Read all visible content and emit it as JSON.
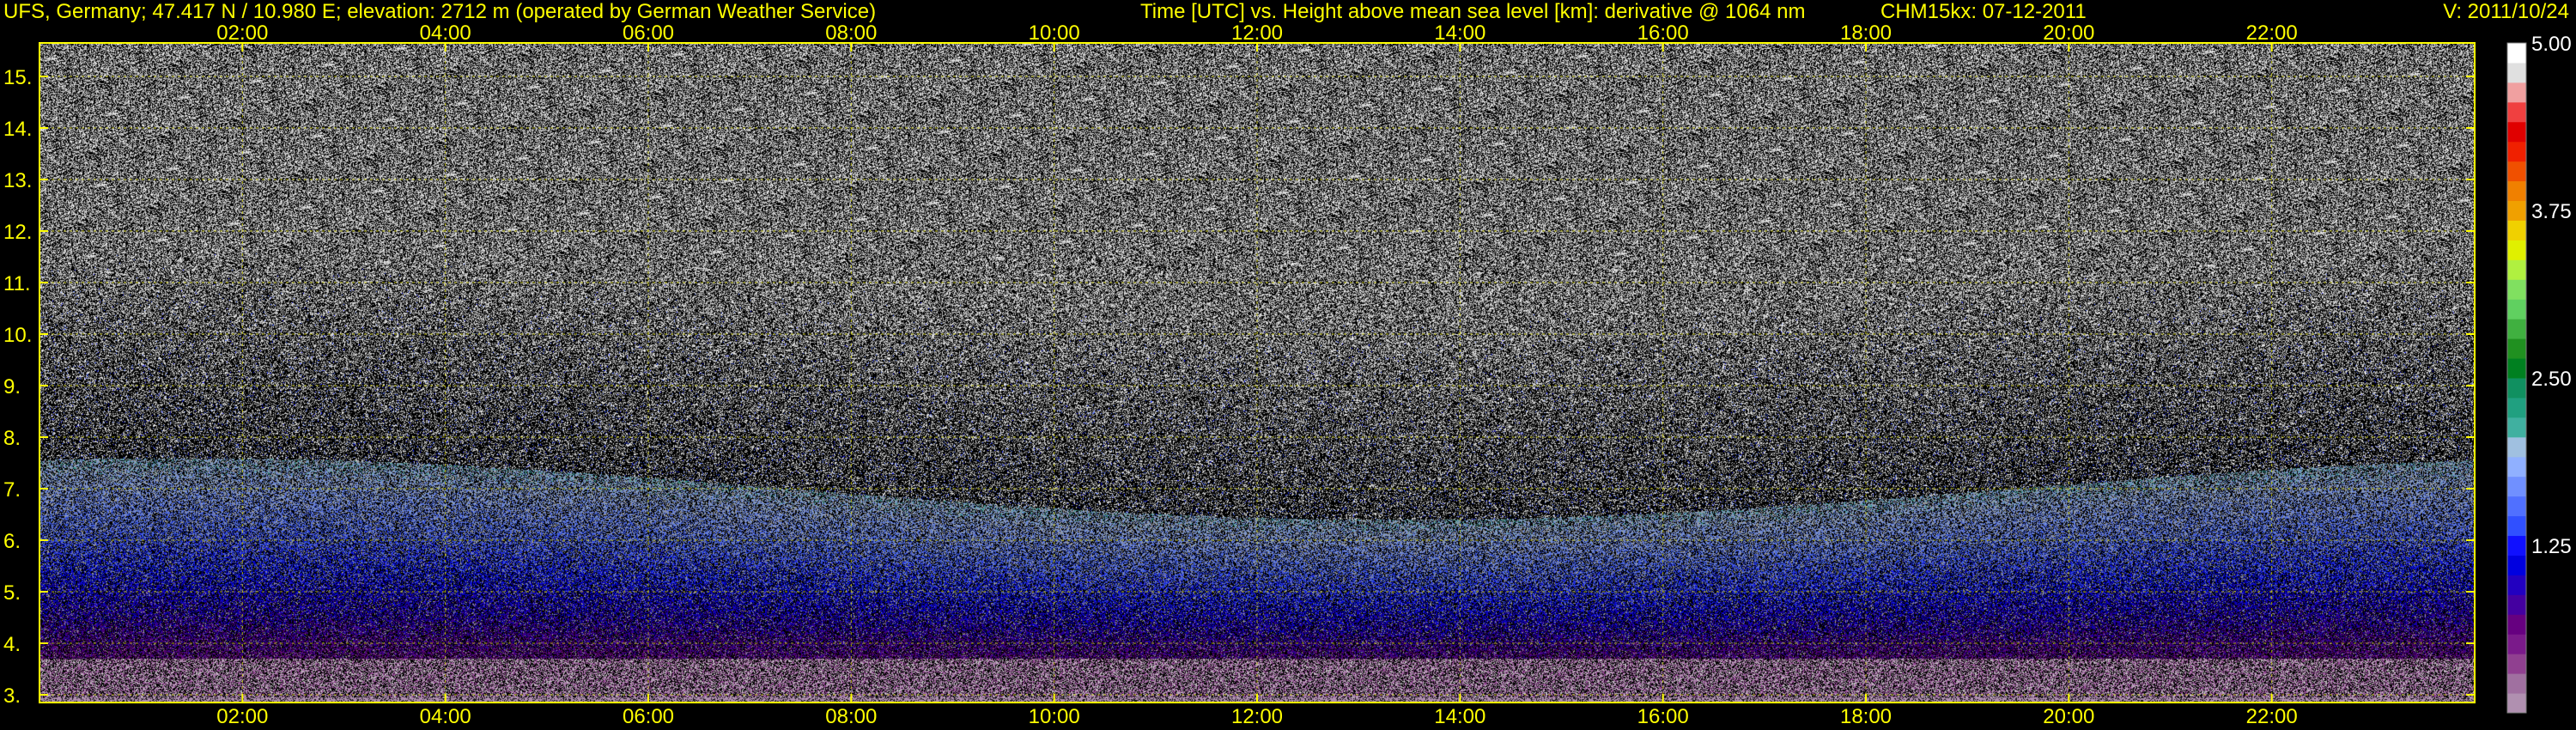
{
  "header": {
    "station": "UFS, Germany; 47.417 N / 10.980 E; elevation: 2712 m  (operated by German Weather Service)",
    "title": "Time [UTC] vs. Height above mean sea level [km]: derivative @ 1064 nm",
    "instrument": "CHM15kx: 07-12-2011",
    "version": "V: 2011/10/24"
  },
  "chart_data": {
    "type": "heatmap",
    "title": "Time [UTC] vs. Height above mean sea level [km]: derivative @ 1064 nm",
    "xlabel": "Time [UTC]",
    "ylabel": "Height above mean sea level [km]",
    "xlim": [
      0,
      24
    ],
    "ylim": [
      2.85,
      15.65
    ],
    "x_ticks": [
      2,
      4,
      6,
      8,
      10,
      12,
      14,
      16,
      18,
      20,
      22
    ],
    "x_tick_labels": [
      "02:00",
      "04:00",
      "06:00",
      "08:00",
      "10:00",
      "12:00",
      "14:00",
      "16:00",
      "18:00",
      "20:00",
      "22:00"
    ],
    "y_ticks": [
      3,
      4,
      5,
      6,
      7,
      8,
      9,
      10,
      11,
      12,
      13,
      14,
      15
    ],
    "y_tick_labels": [
      "3.",
      "4.",
      "5.",
      "6.",
      "7.",
      "8.",
      "9.",
      "10.",
      "11.",
      "12.",
      "13.",
      "14.",
      "15."
    ],
    "grid": true,
    "colorbar": {
      "range": [
        0,
        5
      ],
      "tick_values": [
        1.25,
        2.5,
        3.75,
        5.0
      ],
      "tick_labels": [
        "1.25",
        "2.50",
        "3.75",
        "5.00"
      ],
      "colors": [
        "#b090b0",
        "#a070a0",
        "#904090",
        "#7a1a8a",
        "#660080",
        "#4400a0",
        "#2200c0",
        "#0000e0",
        "#1010ff",
        "#3050ff",
        "#5070ff",
        "#7090ff",
        "#90b0ff",
        "#a0c0e0",
        "#40b0a0",
        "#20a080",
        "#109060",
        "#008020",
        "#209020",
        "#40b040",
        "#60d060",
        "#80e060",
        "#b0f040",
        "#e0f000",
        "#f0d000",
        "#f0a000",
        "#f08000",
        "#f05000",
        "#f02000",
        "#e00000",
        "#f04040",
        "#f0a0a0",
        "#e0e0e0",
        "#ffffff"
      ]
    },
    "description_values": {
      "noise_above_km": 8.5,
      "aerosol_layer_km": [
        3.3,
        7.0
      ],
      "ground_band_km": 2.9
    }
  },
  "colors": {
    "axis": "#ffff00",
    "grid": "#c8c800",
    "background": "#000000"
  }
}
